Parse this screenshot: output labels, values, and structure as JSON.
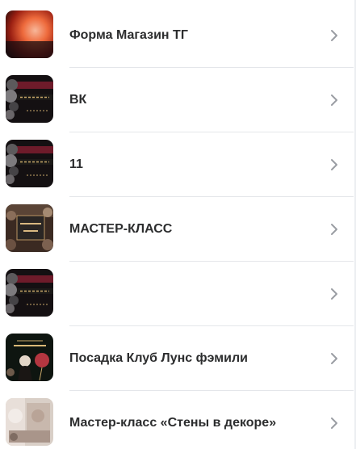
{
  "items": [
    {
      "label": "Форма Магазин ТГ",
      "thumb_icon": "gradient-cover-icon"
    },
    {
      "label": "ВК",
      "thumb_icon": "balloons-banner-icon"
    },
    {
      "label": "11",
      "thumb_icon": "balloons-banner-icon"
    },
    {
      "label": "МАСТЕР-КЛАСС",
      "thumb_icon": "box-cover-icon"
    },
    {
      "label": "",
      "thumb_icon": "balloons-banner-icon"
    },
    {
      "label": "Посадка Клуб Лунс фэмили",
      "thumb_icon": "lunce-family-cover-icon"
    },
    {
      "label": "Мастер-класс «Стены в декоре»",
      "thumb_icon": "wall-decor-cover-icon"
    }
  ],
  "colors": {
    "text": "#2c2d2e",
    "chevron": "#9a9da3",
    "divider": "#e4e6ea"
  },
  "chevron_icon": "chevron-right-icon"
}
